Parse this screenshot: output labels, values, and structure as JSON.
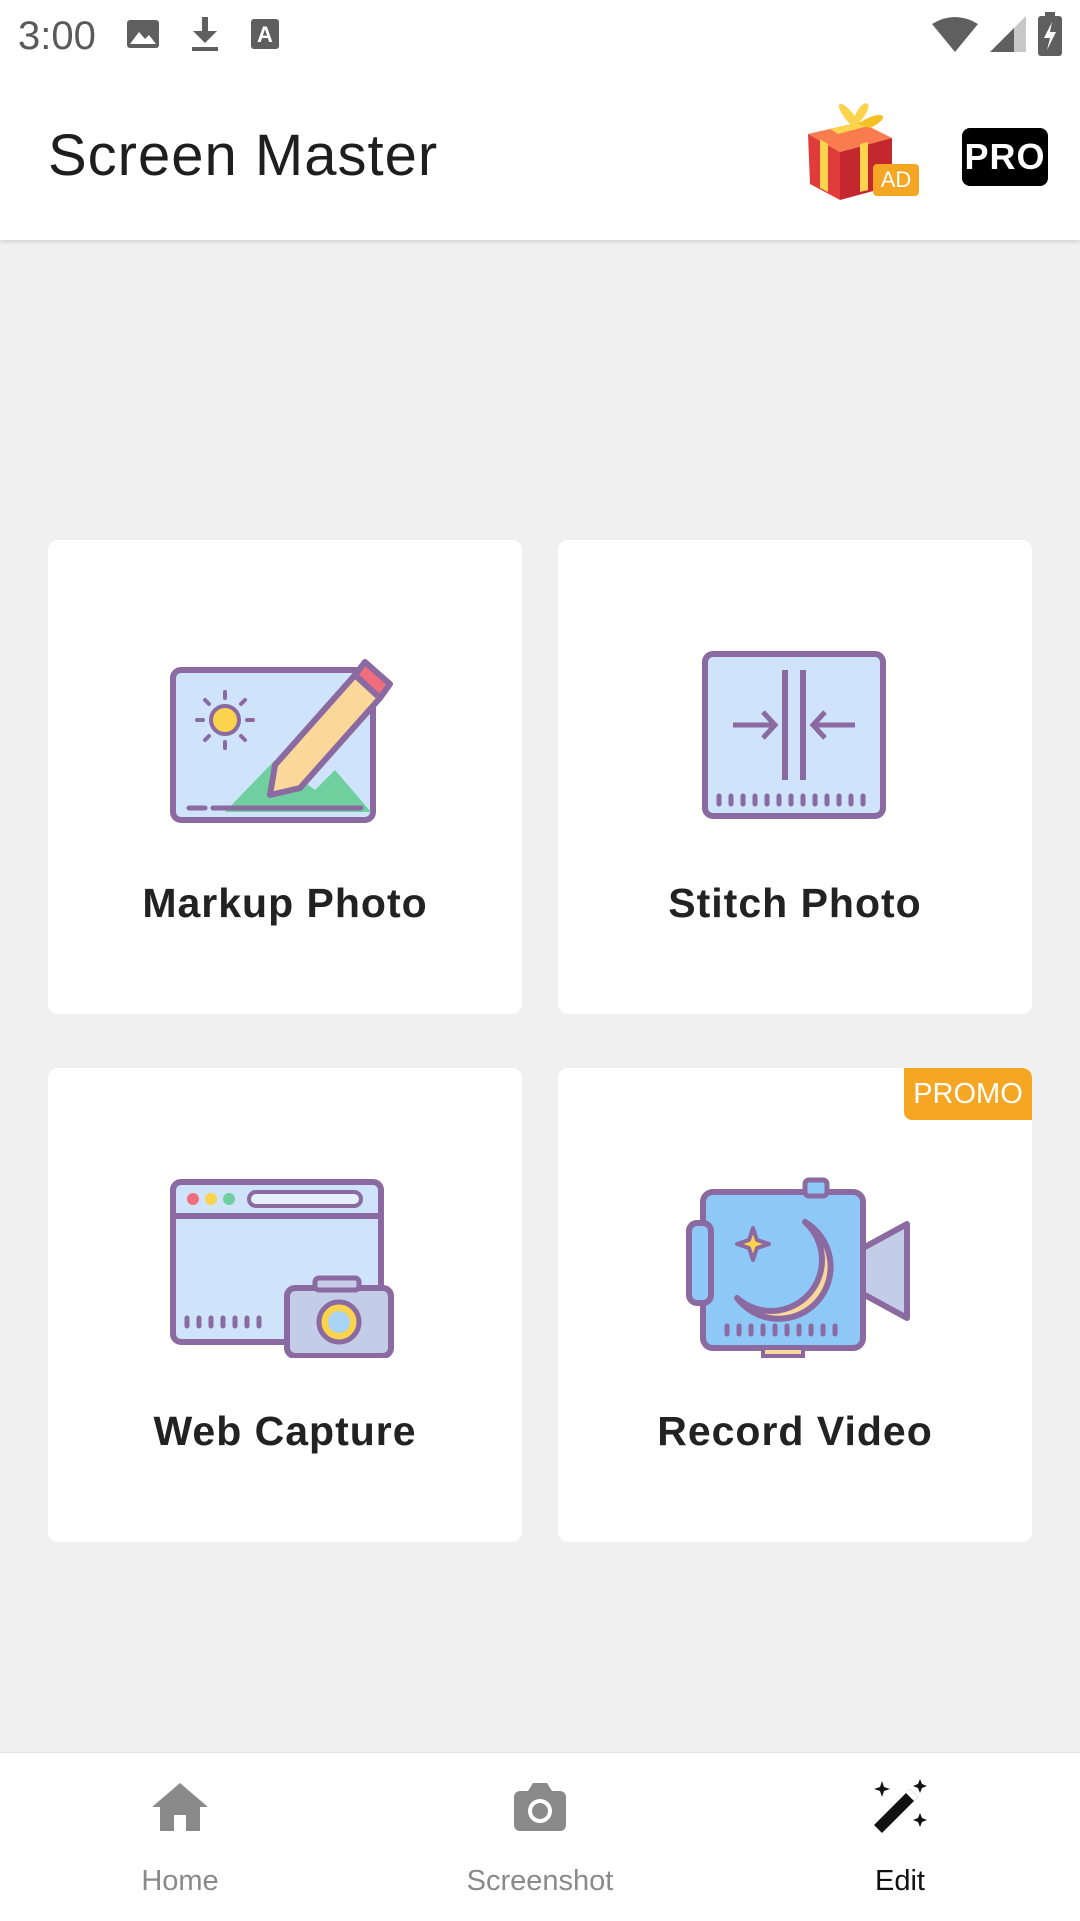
{
  "status_bar": {
    "time": "3:00",
    "left_icons": [
      "image-icon",
      "download-icon",
      "font-icon"
    ],
    "right_icons": [
      "wifi-icon",
      "signal-icon",
      "battery-charging-icon"
    ]
  },
  "app_bar": {
    "title": "Screen Master",
    "ad_badge": "AD",
    "pro_label": "PRO"
  },
  "tools": [
    {
      "label": "Markup Photo",
      "icon": "markup-photo-icon"
    },
    {
      "label": "Stitch Photo",
      "icon": "stitch-photo-icon"
    },
    {
      "label": "Web Capture",
      "icon": "web-capture-icon"
    },
    {
      "label": "Record Video",
      "icon": "record-video-icon",
      "badge": "PROMO"
    }
  ],
  "bottom_nav": {
    "items": [
      {
        "label": "Home",
        "icon": "home-icon",
        "active": false
      },
      {
        "label": "Screenshot",
        "icon": "camera-icon",
        "active": false
      },
      {
        "label": "Edit",
        "icon": "magic-wand-icon",
        "active": true
      }
    ]
  },
  "colors": {
    "accent_orange": "#f5a623",
    "outline_purple": "#8a6aa0",
    "fill_blue": "#cfe4fb",
    "active_text": "#111111",
    "inactive_text": "#8a8a8a"
  }
}
